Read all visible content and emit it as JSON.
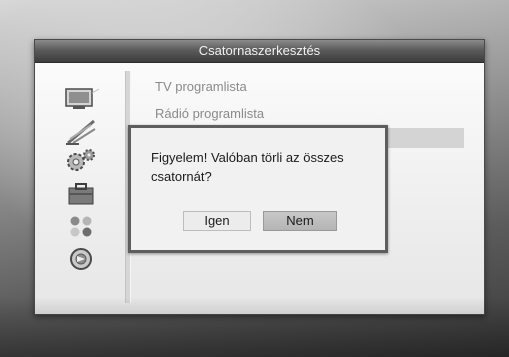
{
  "window": {
    "title": "Csatornaszerkesztés"
  },
  "sidebar": {
    "icons": [
      "tv-icon",
      "satellite-dish-icon",
      "gears-icon",
      "toolbox-icon",
      "dots-icon",
      "disc-icon"
    ]
  },
  "menu": {
    "items": [
      {
        "label": "TV programlista"
      },
      {
        "label": "Rádió programlista"
      }
    ],
    "highlighted_index": 2
  },
  "dialog": {
    "message": "Figyelem! Valóban törli az összes csatornát?",
    "yes_label": "Igen",
    "no_label": "Nem",
    "selected": "Nem"
  }
}
